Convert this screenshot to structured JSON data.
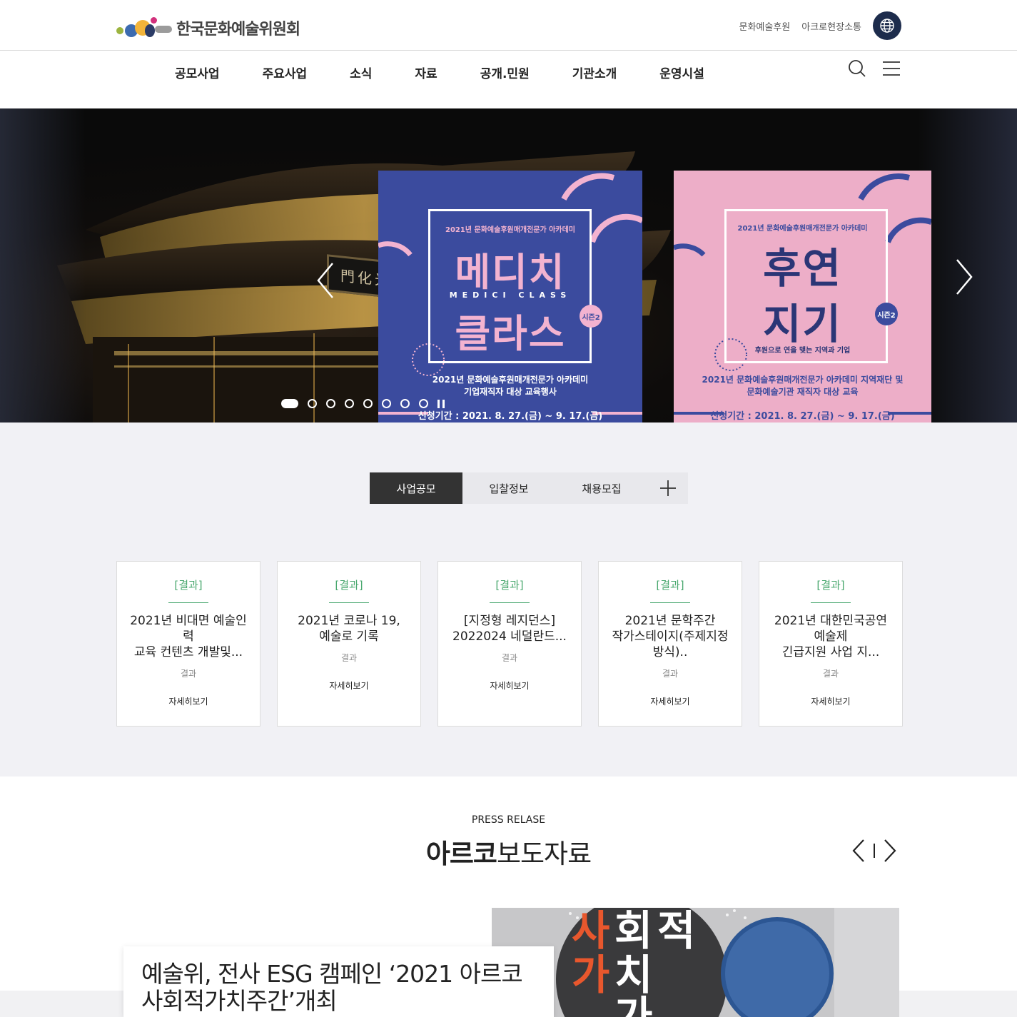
{
  "header": {
    "org_name": "한국문화예술위원회",
    "util_links": [
      "문화예술후원",
      "아크로현장소통"
    ]
  },
  "nav": {
    "items": [
      "공모사업",
      "주요사업",
      "소식",
      "자료",
      "공개.민원",
      "기관소개",
      "운영시설"
    ]
  },
  "hero": {
    "palace_sign": "門化光",
    "slide_count": 8,
    "active_slide": 1,
    "posters": [
      {
        "top_text": "2021년 문화예술후원매개전문가 아카데미",
        "title_line1": "메디치",
        "title_mid": "MEDICI CLASS",
        "title_line2": "클라스",
        "badge": "시즌2",
        "sub_line1": "2021년 문화예술후원매개전문가 아카데미",
        "sub_line2": "기업재직자 대상 교육행사",
        "period": "신청기간 : 2021. 8. 27.(금) ~ 9. 17.(금)",
        "bg_color": "#3b4b9e",
        "accent_color": "#f3b3d0"
      },
      {
        "top_text": "2021년 문화예술후원매개전문가 아카데미",
        "title_line1": "후연",
        "title_line2": "지기",
        "badge": "시즌2",
        "tagline": "후원으로 연을 맺는 지역과 기업",
        "sub_line1": "2021년 문화예술후원매개전문가 아카데미 지역재단 및",
        "sub_line2": "문화예술기관 재직자 대상 교육",
        "period": "신청기간 : 2021. 8. 27.(금) ~ 9. 17.(금)",
        "bg_color": "#edaec8",
        "accent_color": "#3b4b9e"
      }
    ]
  },
  "notice": {
    "tabs": [
      "사업공모",
      "입찰정보",
      "채용모집"
    ],
    "active_tab": 0,
    "more_label": "+",
    "cards": [
      {
        "tag": "[결과]",
        "title": "2021년 비대면 예술인력\n교육 컨텐츠 개발및...",
        "sub": "결과",
        "more": "자세히보기"
      },
      {
        "tag": "[결과]",
        "title": "2021년 코로나 19,\n예술로 기록",
        "sub": "결과",
        "more": "자세히보기"
      },
      {
        "tag": "[결과]",
        "title": "[지정형 레지던스]\n2022024 네덜란드...",
        "sub": "결과",
        "more": "자세히보기"
      },
      {
        "tag": "[결과]",
        "title": "2021년 문학주간\n작가스테이지(주제지정방식)..",
        "sub": "결과",
        "more": "자세히보기"
      },
      {
        "tag": "[결과]",
        "title": "2021년 대한민국공연예술제\n긴급지원 사업 지...",
        "sub": "결과",
        "more": "자세히보기"
      }
    ]
  },
  "press": {
    "label": "PRESS RELASE",
    "title_bold": "아르코",
    "title_rest": "보도자료",
    "headline": "예술위, 전사 ESG 캠페인 ‘2021 아르코 사회적가치주간’개최",
    "image_text": [
      "사",
      "회",
      "적",
      "가",
      "치",
      "가"
    ]
  },
  "colors": {
    "navy": "#1d2c4c",
    "green_tag": "#4aa86f",
    "tab_active": "#333333",
    "section_gray": "#f1f1f5"
  }
}
